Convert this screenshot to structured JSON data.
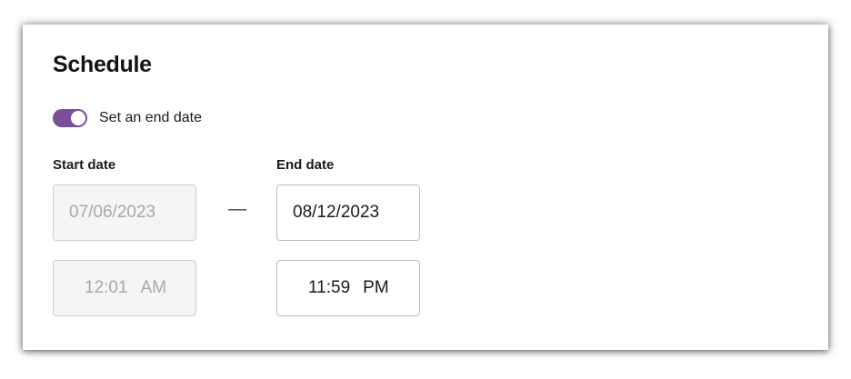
{
  "schedule": {
    "title": "Schedule",
    "end_date_toggle": {
      "label": "Set an end date",
      "on": true,
      "color": "#7a4f9a"
    },
    "start": {
      "label": "Start date",
      "date": "07/06/2023",
      "time": "12:01",
      "ampm": "AM",
      "disabled": true
    },
    "separator": "—",
    "end": {
      "label": "End date",
      "date": "08/12/2023",
      "time": "11:59",
      "ampm": "PM",
      "disabled": false
    }
  }
}
